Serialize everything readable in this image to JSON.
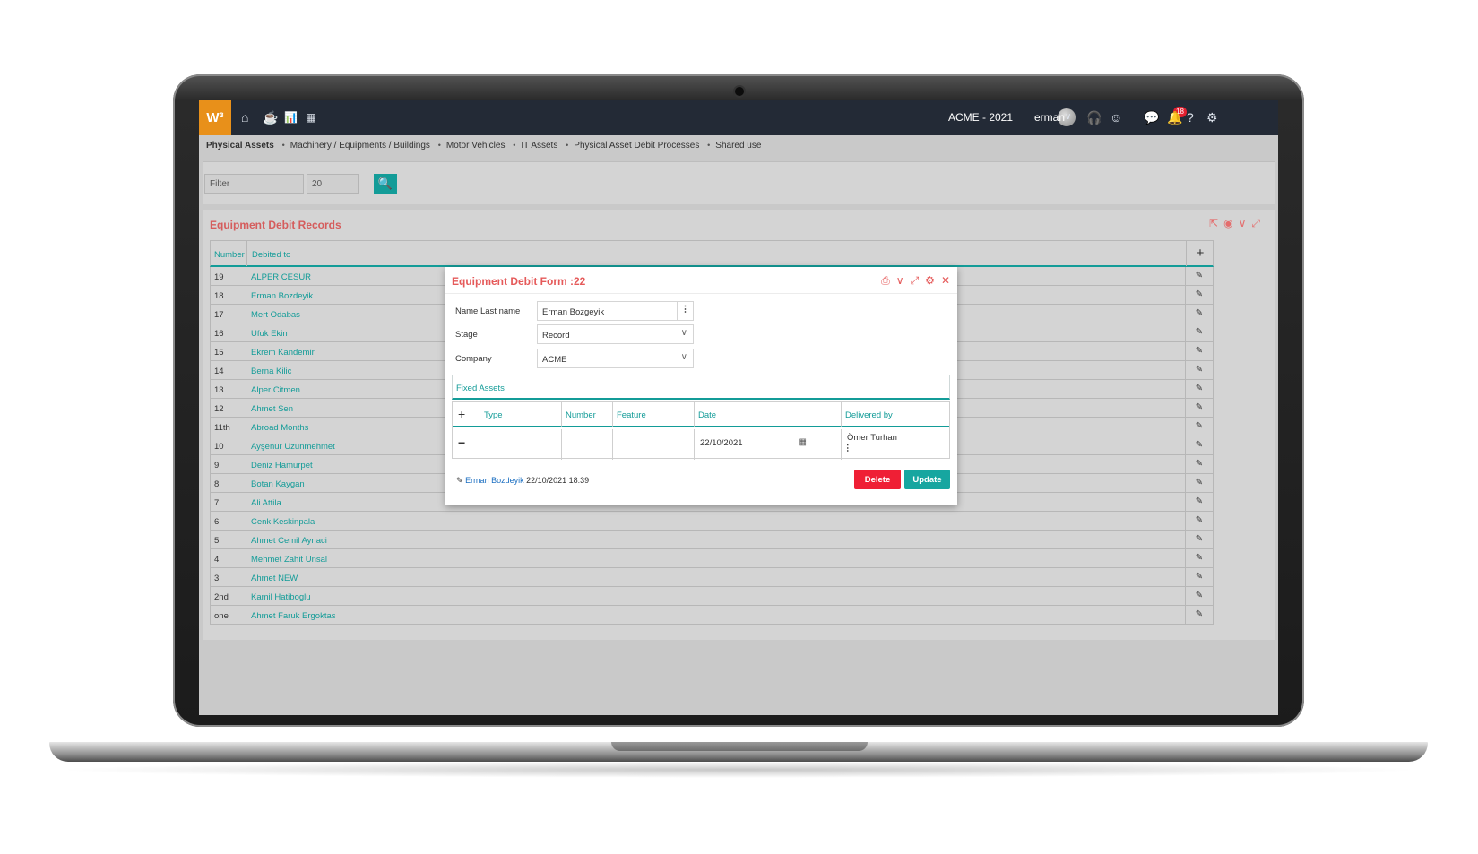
{
  "topbar": {
    "logo": "W³",
    "company_period": "ACME - 2021",
    "user": "erman",
    "notification_count": "18"
  },
  "breadcrumb": {
    "items": [
      "Physical Assets",
      "Machinery / Equipments / Buildings",
      "Motor Vehicles",
      "IT Assets",
      "Physical Asset Debit Processes",
      "Shared use"
    ]
  },
  "filter": {
    "placeholder": "Filter",
    "page_size": "20"
  },
  "list": {
    "title": "Equipment Debit Records",
    "columns": [
      "Number",
      "Debited to"
    ],
    "rows": [
      {
        "number": "19",
        "name": "ALPER CESUR"
      },
      {
        "number": "18",
        "name": "Erman Bozdeyik"
      },
      {
        "number": "17",
        "name": "Mert Odabas"
      },
      {
        "number": "16",
        "name": "Ufuk Ekin"
      },
      {
        "number": "15",
        "name": "Ekrem Kandemir"
      },
      {
        "number": "14",
        "name": "Berna Kilic"
      },
      {
        "number": "13",
        "name": "Alper Citmen"
      },
      {
        "number": "12",
        "name": "Ahmet Sen"
      },
      {
        "number": "11th",
        "name": "Abroad Months"
      },
      {
        "number": "10",
        "name": "Ayşenur Uzunmehmet"
      },
      {
        "number": "9",
        "name": "Deniz Hamurpet"
      },
      {
        "number": "8",
        "name": "Botan Kaygan"
      },
      {
        "number": "7",
        "name": "Ali Attila"
      },
      {
        "number": "6",
        "name": "Cenk Keskinpala"
      },
      {
        "number": "5",
        "name": "Ahmet Cemil Aynaci"
      },
      {
        "number": "4",
        "name": "Mehmet Zahit Unsal"
      },
      {
        "number": "3",
        "name": "Ahmet NEW"
      },
      {
        "number": "2nd",
        "name": "Kamil Hatiboglu"
      },
      {
        "number": "one",
        "name": "Ahmet Faruk Ergoktas"
      }
    ]
  },
  "modal": {
    "title": "Equipment Debit Form :22",
    "fields": {
      "name_label": "Name Last name",
      "name_value": "Erman Bozgeyik",
      "stage_label": "Stage",
      "stage_value": "Record",
      "company_label": "Company",
      "company_value": "ACME"
    },
    "fixed_assets": {
      "title": "Fixed Assets",
      "columns": [
        "Type",
        "Number",
        "Feature",
        "Date",
        "Delivered by"
      ],
      "row": {
        "type": "",
        "number": "",
        "feature": "",
        "date": "22/10/2021",
        "delivered_by": "Ömer Turhan"
      }
    },
    "footer": {
      "edited_by": "Erman Bozdeyik",
      "timestamp": "22/10/2021 18:39"
    },
    "buttons": {
      "delete": "Delete",
      "update": "Update"
    }
  },
  "colors": {
    "accent": "#139c98",
    "title_red": "#e55a5a",
    "delete": "#ef1f35",
    "topbar": "#232a36",
    "logo": "#e8901a"
  }
}
